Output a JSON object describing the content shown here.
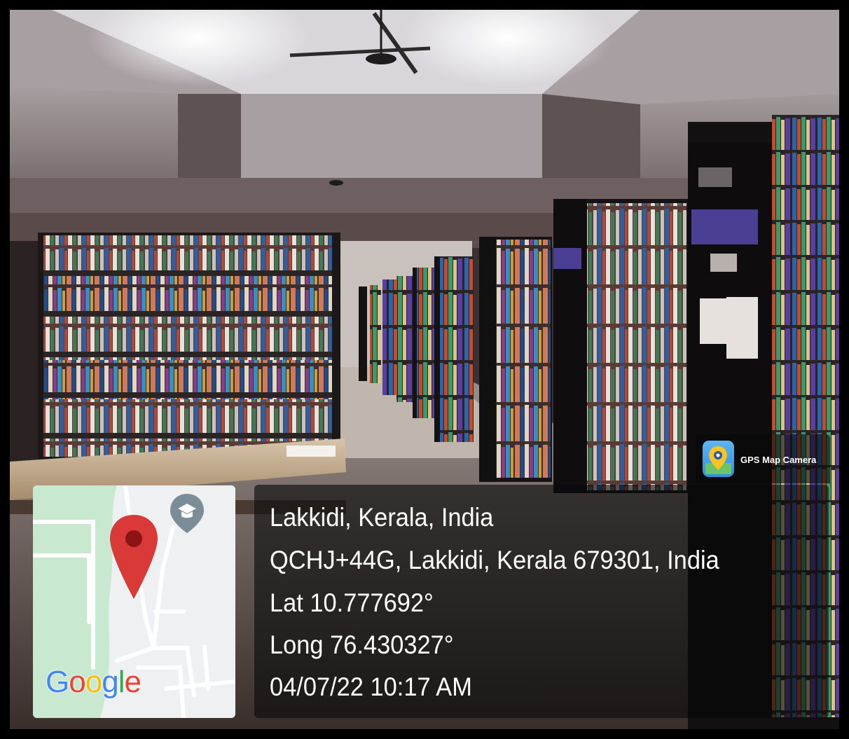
{
  "watermark": {
    "app_name": "GPS Map Camera",
    "map_logo": "Google",
    "place_title": "Lakkidi, Kerala, India",
    "address": "QCHJ+44G, Lakkidi, Kerala 679301, India",
    "latitude": "Lat 10.777692°",
    "longitude": "Long 76.430327°",
    "datetime": "04/07/22 10:17 AM"
  },
  "icons": [
    "map-pin-icon",
    "school-marker-icon",
    "gps-map-camera-app-icon"
  ],
  "colors": {
    "pin_red": "#d93a37",
    "school_marker": "#7b8d96",
    "map_green": "#c9e8d0",
    "map_road": "#ffffff",
    "panel_bg": "rgba(10,10,12,0.62)"
  }
}
